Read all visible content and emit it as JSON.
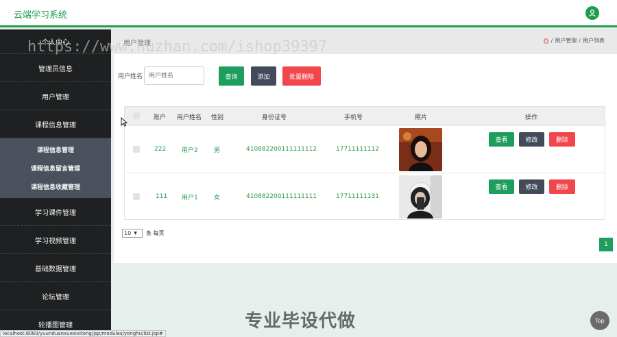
{
  "app": {
    "title": "云端学习系统"
  },
  "sidebar": {
    "items": [
      {
        "label": "个人中心"
      },
      {
        "label": "管理员信息"
      },
      {
        "label": "用户管理"
      },
      {
        "label": "课程信息管理"
      },
      {
        "label": "学习课件管理"
      },
      {
        "label": "学习视频管理"
      },
      {
        "label": "基础数据管理"
      },
      {
        "label": "论坛管理"
      },
      {
        "label": "轮播图管理"
      }
    ],
    "subitems": [
      {
        "label": "课程信息管理"
      },
      {
        "label": "课程信息留言管理"
      },
      {
        "label": "课程信息收藏管理"
      }
    ]
  },
  "header": {
    "page_title": "用户管理",
    "breadcrumb": {
      "sep": "/",
      "level1": "用户管理",
      "level2": "用户列表"
    }
  },
  "search": {
    "label": "用户姓名",
    "placeholder": "用户姓名",
    "search_btn": "查询",
    "add_btn": "添加",
    "batch_delete_btn": "批量删除"
  },
  "table": {
    "columns": [
      "账户",
      "用户姓名",
      "性别",
      "身份证号",
      "手机号",
      "照片",
      "操作"
    ],
    "rows": [
      {
        "account": "222",
        "name": "用户2",
        "gender": "男",
        "id_card": "410882200111111112",
        "phone": "17711111112",
        "photo": "photo-1"
      },
      {
        "account": "111",
        "name": "用户1",
        "gender": "女",
        "id_card": "410882200111111111",
        "phone": "17711111131",
        "photo": "photo-2"
      }
    ],
    "actions": {
      "view": "查看",
      "edit": "修改",
      "delete": "删除"
    }
  },
  "pagination": {
    "page_size": "10",
    "per_page_label": "条 每页",
    "current_page": "1"
  },
  "overlay": {
    "watermark_url": "https://www.huzhan.com/ishop39397",
    "watermark_text": "专业毕设代做",
    "status_url": "localhost:8080/yuunduanxuexixitong/jsp/modules/yonghu/list.jsp#",
    "top_label": "Top"
  },
  "colors": {
    "primary": "#1e9e5c",
    "dark": "#434b5a",
    "danger": "#f2464d",
    "sidebar": "#1f2021",
    "submenu": "#4a505c"
  },
  "icons": {
    "user": "user-icon",
    "home": "home-icon",
    "cursor": "cursor-icon"
  }
}
